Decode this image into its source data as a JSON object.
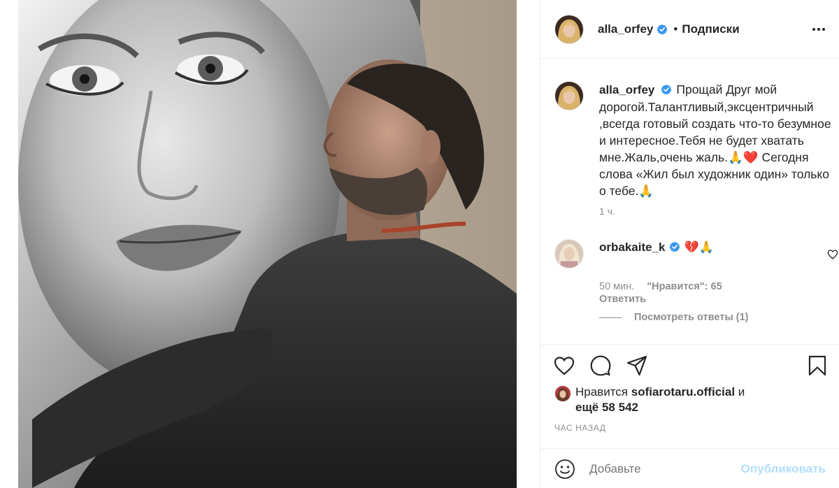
{
  "header": {
    "username": "alla_orfey",
    "separator": "•",
    "follow_label": "Подписки"
  },
  "caption": {
    "username": "alla_orfey",
    "text": "Прощай Друг мой дорогой.Талантливый,эксцентричный ,всегда готовый создать что-то безумное и интересное.Тебя не будет хватать мне.Жаль,очень жаль.🙏❤️ Сегодня слова «Жил был художник один» только о тебе.🙏",
    "time": "1 ч."
  },
  "comment": {
    "username": "orbakaite_k",
    "text": "💔🙏",
    "time": "50 мин.",
    "likes": "\"Нравится\": 65",
    "reply_label": "Ответить"
  },
  "view_replies": "Посмотреть ответы (1)",
  "likes": {
    "prefix": "Нравится",
    "user": "sofiarotaru.official",
    "and": "и",
    "more": "ещё 58 542"
  },
  "posted": "ЧАС НАЗАД",
  "add_comment": {
    "placeholder": "Добавьте",
    "publish_label": "Опубликовать"
  },
  "colors": {
    "verified": "#3897f0",
    "muted": "#8e8e8e",
    "publish_disabled": "#b2dffc",
    "border": "#efefef"
  },
  "icons": [
    "more-icon",
    "verified-icon",
    "heart-icon",
    "comment-icon",
    "share-icon",
    "bookmark-icon",
    "emoji-icon"
  ]
}
